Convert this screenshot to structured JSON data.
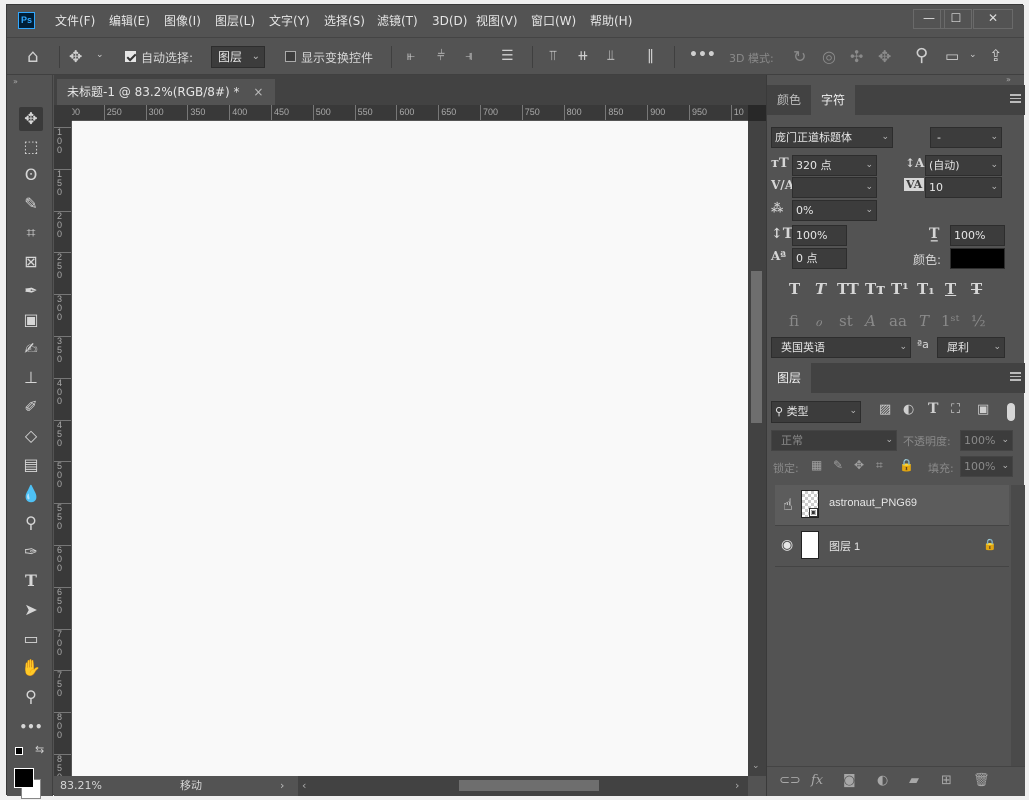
{
  "app": {
    "logo": "Ps"
  },
  "menu": [
    "文件(F)",
    "编辑(E)",
    "图像(I)",
    "图层(L)",
    "文字(Y)",
    "选择(S)",
    "滤镜(T)",
    "3D(D)",
    "视图(V)",
    "窗口(W)",
    "帮助(H)"
  ],
  "window_controls": {
    "minimize": "—",
    "maximize": "☐",
    "close": "✕"
  },
  "options": {
    "auto_select_label": "自动选择:",
    "auto_select_checked": true,
    "auto_select_value": "图层",
    "show_transform_label": "显示变换控件",
    "show_transform_checked": false,
    "mode_3d_label": "3D 模式:"
  },
  "document": {
    "tab_title": "未标题-1 @ 83.2%(RGB/8#) *",
    "close": "×",
    "ruler_h": [
      "200",
      "250",
      "300",
      "350",
      "400",
      "450",
      "500",
      "550",
      "600",
      "650",
      "700",
      "750",
      "800",
      "850",
      "900",
      "950",
      "10"
    ],
    "ruler_v": [
      "1\n0\n0",
      "1\n5\n0",
      "2\n0\n0",
      "2\n5\n0",
      "3\n0\n0",
      "3\n5\n0",
      "4\n0\n0",
      "4\n5\n0",
      "5\n0\n0",
      "5\n5\n0",
      "6\n0\n0",
      "6\n5\n0",
      "7\n0\n0",
      "7\n5\n0",
      "8\n0\n0",
      "8\n5\n0"
    ],
    "zoom": "83.21%",
    "status": "移动"
  },
  "character_panel": {
    "tabs": [
      "颜色",
      "字符"
    ],
    "active_tab": "字符",
    "font_family": "庞门正道标题体",
    "font_style": "-",
    "font_size": "320 点",
    "leading": "(自动)",
    "kerning": "",
    "tracking": "10",
    "tsume": "0%",
    "vertical_scale": "100%",
    "horizontal_scale": "100%",
    "baseline_shift": "0 点",
    "color_label": "颜色:",
    "color_value": "#000000",
    "language": "英国英语",
    "antialias_label": "ªa",
    "antialias": "犀利"
  },
  "layers_panel": {
    "tab": "图层",
    "filter": "类型",
    "blend_mode": "正常",
    "opacity_label": "不透明度:",
    "opacity": "100%",
    "lock_label": "锁定:",
    "fill_label": "填充:",
    "fill": "100%",
    "layers": [
      {
        "name": "astronaut_PNG69",
        "visible": false,
        "locked": false,
        "type": "smart-object"
      },
      {
        "name": "图层 1",
        "visible": true,
        "locked": true,
        "type": "pixel"
      }
    ]
  }
}
